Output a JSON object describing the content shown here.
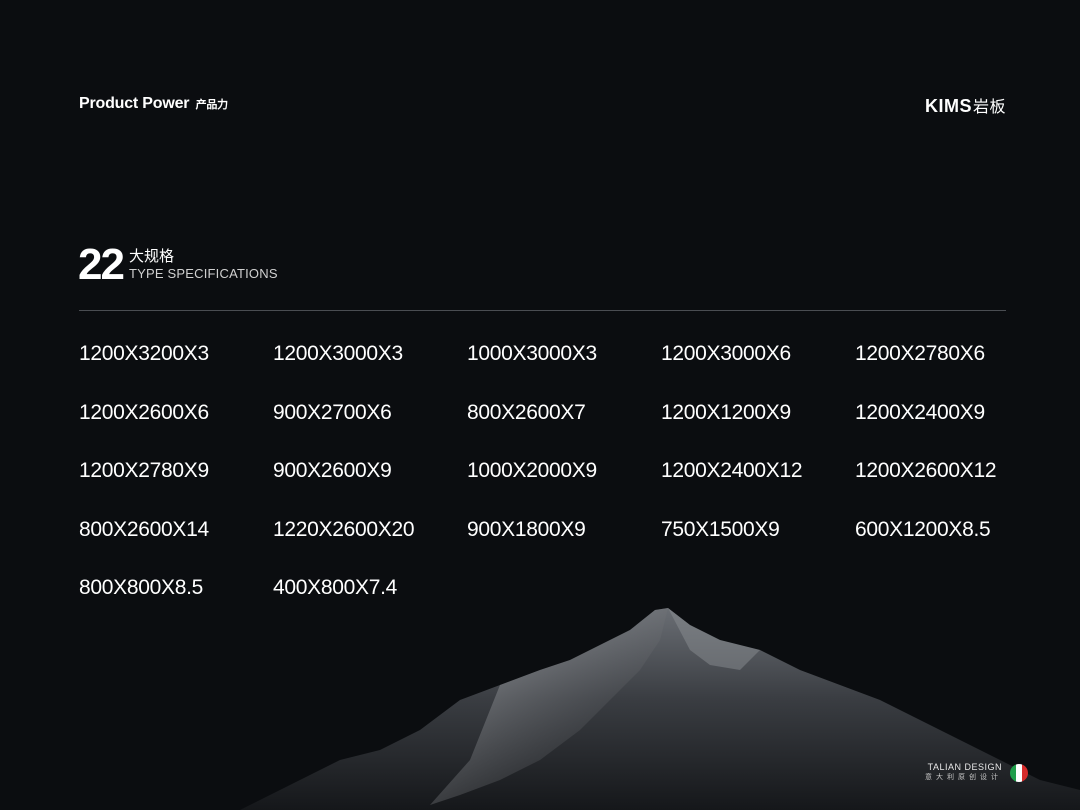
{
  "header": {
    "title": "Product Power",
    "subtitle": "产品力",
    "brand": "KIMS",
    "brand_cn": "岩板"
  },
  "section": {
    "number": "22",
    "title_cn": "大规格",
    "title_en": "TYPE SPECIFICATIONS"
  },
  "specs": [
    "1200X3200X3",
    "1200X3000X3",
    "1000X3000X3",
    "1200X3000X6",
    "1200X2780X6",
    "1200X2600X6",
    "900X2700X6",
    "800X2600X7",
    "1200X1200X9",
    "1200X2400X9",
    "1200X2780X9",
    "900X2600X9",
    "1000X2000X9",
    "1200X2400X12",
    "1200X2600X12",
    "800X2600X14",
    "1220X2600X20",
    "900X1800X9",
    "750X1500X9",
    "600X1200X8.5",
    "800X800X8.5",
    "400X800X7.4"
  ],
  "footer": {
    "logo_en": "TALIAN DESIGN",
    "logo_cn": "意大利原创设计",
    "flag_colors": [
      "#1f9d4a",
      "#ffffff",
      "#d62b2b"
    ]
  },
  "colors": {
    "background": "#0b0d10",
    "text": "#ffffff",
    "divider": "#4a4d52"
  }
}
